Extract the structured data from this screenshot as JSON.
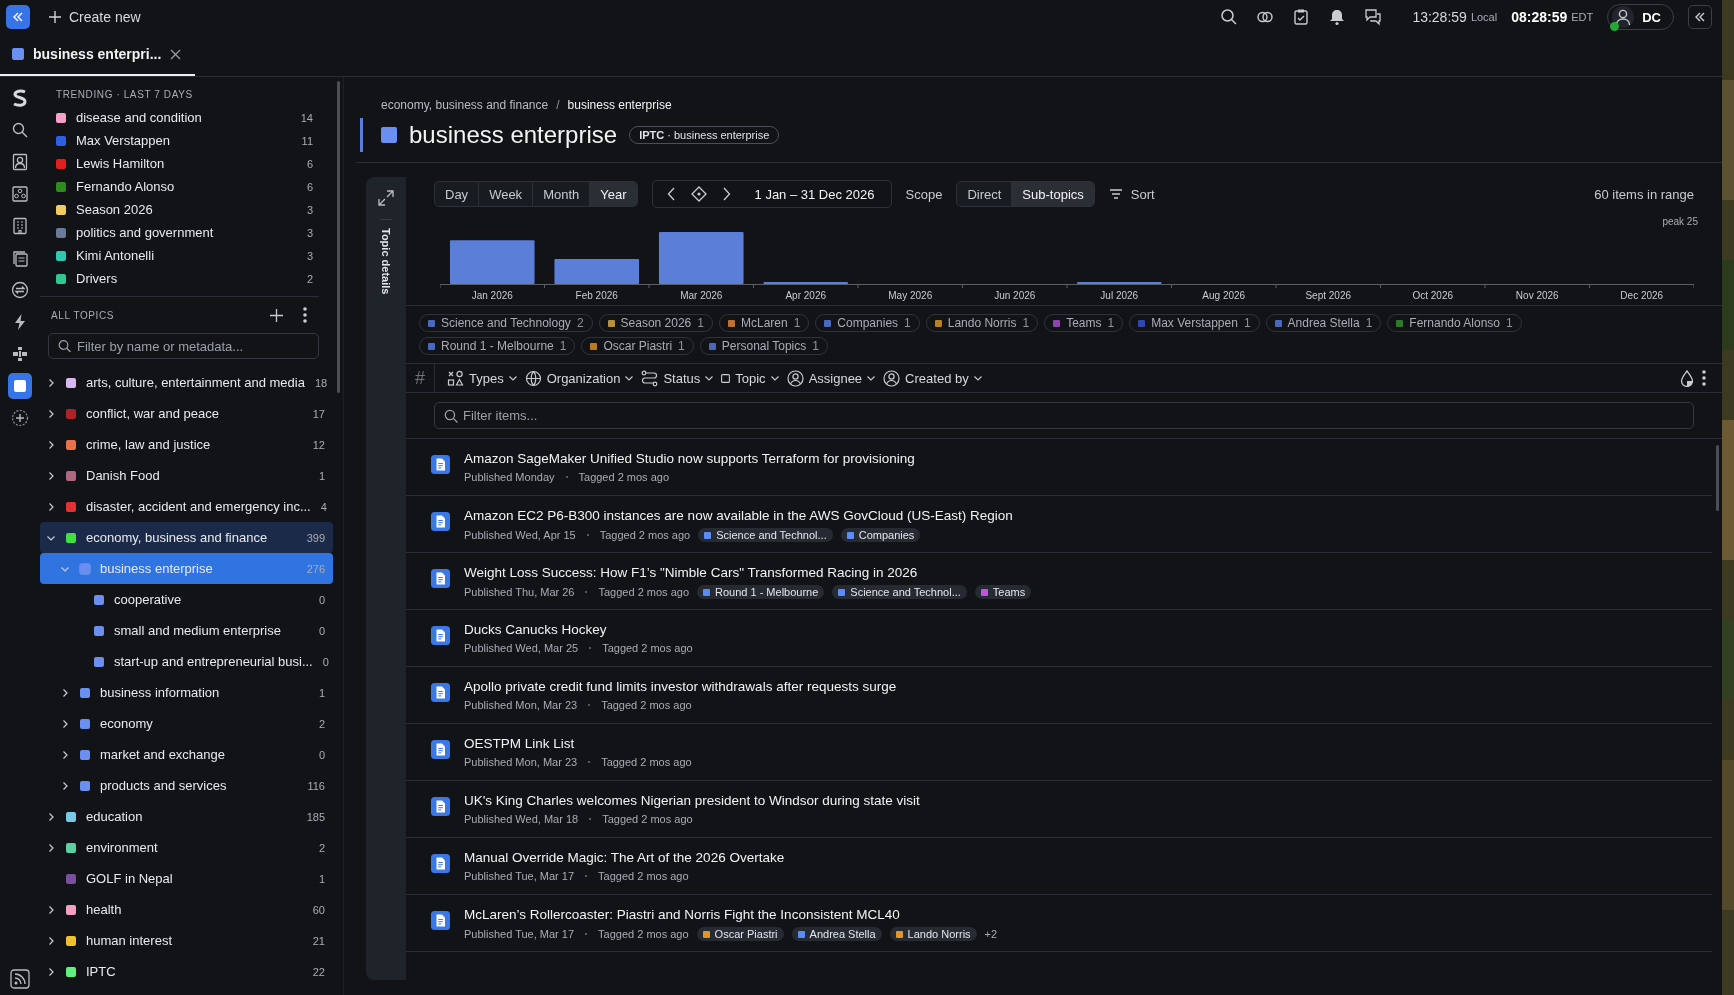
{
  "top_bar": {
    "create_label": "Create new",
    "local_time": "13:28:59",
    "local_label": "Local",
    "remote_time": "08:28:59",
    "remote_label": "EDT",
    "user_initials": "DC"
  },
  "rail": [
    {
      "selected": false
    },
    {
      "selected": false
    },
    {
      "selected": false
    },
    {
      "selected": false
    },
    {
      "selected": false
    },
    {
      "selected": false
    },
    {
      "selected": false
    },
    {
      "selected": false
    },
    {
      "selected": false
    },
    {
      "selected": true
    },
    {
      "selected": false
    }
  ],
  "tabs": [
    {
      "label": "business enterpri...",
      "selected": true
    }
  ],
  "sidebar": {
    "trending_title": "TRENDING · LAST 7 DAYS",
    "trending": [
      {
        "label": "disease and condition",
        "count": "14",
        "color": "#f5a0c8"
      },
      {
        "label": "Max Verstappen",
        "count": "11",
        "color": "#2f5fe0"
      },
      {
        "label": "Lewis Hamilton",
        "count": "6",
        "color": "#e02020"
      },
      {
        "label": "Fernando Alonso",
        "count": "6",
        "color": "#2f8a20"
      },
      {
        "label": "Season 2026",
        "count": "3",
        "color": "#f0cc60"
      },
      {
        "label": "politics and government",
        "count": "3",
        "color": "#6a7a9a"
      },
      {
        "label": "Kimi Antonelli",
        "count": "3",
        "color": "#30c8b0"
      },
      {
        "label": "Drivers",
        "count": "2",
        "color": "#30c890"
      }
    ],
    "all_topics_title": "ALL TOPICS",
    "filter_placeholder": "Filter by name or metadata...",
    "tree": [
      {
        "label": "arts, culture, entertainment and media",
        "count": "18",
        "color": "#d6b8f0",
        "expanded": false,
        "selected": false
      },
      {
        "label": "conflict, war and peace",
        "count": "17",
        "color": "#b0202a",
        "expanded": false,
        "selected": false
      },
      {
        "label": "crime, law and justice",
        "count": "12",
        "color": "#e8704a",
        "expanded": false,
        "selected": false
      },
      {
        "label": "Danish Food",
        "count": "1",
        "color": "#b06880",
        "expanded": false,
        "selected": false
      },
      {
        "label": "disaster, accident and emergency inc...",
        "count": "4",
        "color": "#e83030",
        "expanded": false,
        "selected": false
      },
      {
        "label": "economy, business and finance",
        "count": "399",
        "color": "#40e040",
        "expanded": true,
        "selected": false,
        "children": [
          {
            "label": "business enterprise",
            "count": "276",
            "color": "#6b8ff0",
            "expanded": true,
            "selected": true,
            "children": [
              {
                "label": "cooperative",
                "count": "0",
                "color": "#6b8ff0",
                "selected": false
              },
              {
                "label": "small and medium enterprise",
                "count": "0",
                "color": "#6b8ff0",
                "selected": false
              },
              {
                "label": "start-up and entrepreneurial busi...",
                "count": "0",
                "color": "#6b8ff0",
                "selected": false
              }
            ]
          },
          {
            "label": "business information",
            "count": "1",
            "color": "#6b8ff0",
            "expanded": false,
            "selected": false
          },
          {
            "label": "economy",
            "count": "2",
            "color": "#6b8ff0",
            "expanded": false,
            "selected": false
          },
          {
            "label": "market and exchange",
            "count": "0",
            "color": "#6b8ff0",
            "expanded": false,
            "selected": false
          },
          {
            "label": "products and services",
            "count": "116",
            "color": "#6b8ff0",
            "expanded": false,
            "selected": false
          }
        ]
      },
      {
        "label": "education",
        "count": "185",
        "color": "#7ac8e8",
        "expanded": false,
        "selected": false
      },
      {
        "label": "environment",
        "count": "2",
        "color": "#5ad0a0",
        "expanded": false,
        "selected": false
      },
      {
        "label": "GOLF in Nepal",
        "count": "1",
        "color": "#7a4fa0",
        "selected": false
      },
      {
        "label": "health",
        "count": "60",
        "color": "#f5a0c0",
        "expanded": false,
        "selected": false
      },
      {
        "label": "human interest",
        "count": "21",
        "color": "#f0c030",
        "expanded": false,
        "selected": false
      },
      {
        "label": "IPTC",
        "count": "22",
        "color": "#60f080",
        "expanded": false,
        "selected": false
      }
    ]
  },
  "topic": {
    "breadcrumb": [
      "economy, business and finance",
      "business enterprise"
    ],
    "separator": "/",
    "title": "business enterprise",
    "badge": "**IPTC** · business enterprise"
  },
  "side_tab": "Topic details",
  "ranges": [
    {
      "label": "Day",
      "selected": false
    },
    {
      "label": "Week",
      "selected": false
    },
    {
      "label": "Month",
      "selected": false
    },
    {
      "label": "Year",
      "selected": true
    }
  ],
  "date_range": "1 Jan – 31 Dec 2026",
  "scope_label": "Scope",
  "scopes": [
    {
      "label": "Direct",
      "selected": false
    },
    {
      "label": "Sub-topics",
      "selected": true
    }
  ],
  "sort_label": "Sort",
  "count_label": "60 items in range",
  "timeline": {
    "peak_label": "peak 25",
    "months": [
      "Jan 2026",
      "Feb 2026",
      "Mar 2026",
      "Apr 2026",
      "May 2026",
      "Jun 2026",
      "Jul 2026",
      "Aug 2026",
      "Sept 2026",
      "Oct 2026",
      "Nov 2026",
      "Dec 2026"
    ]
  },
  "topic_chips": [
    {
      "label": "Science and Technology",
      "count": "2",
      "color": "#4a68c0"
    },
    {
      "label": "Season 2026",
      "count": "1",
      "color": "#b8913a"
    },
    {
      "label": "McLaren",
      "count": "1",
      "color": "#c07030"
    },
    {
      "label": "Companies",
      "count": "1",
      "color": "#4a68c0"
    },
    {
      "label": "Lando Norris",
      "count": "1",
      "color": "#b88020"
    },
    {
      "label": "Teams",
      "count": "1",
      "color": "#9040b0"
    },
    {
      "label": "Max Verstappen",
      "count": "1",
      "color": "#2f48b0"
    },
    {
      "label": "Andrea Stella",
      "count": "1",
      "color": "#4a68c0"
    },
    {
      "label": "Fernando Alonso",
      "count": "1",
      "color": "#2f7a2a"
    },
    {
      "label": "Round 1 - Melbourne",
      "count": "1",
      "color": "#4a68c0"
    },
    {
      "label": "Oscar Piastri",
      "count": "1",
      "color": "#b87a20"
    },
    {
      "label": "Personal Topics",
      "count": "1",
      "color": "#4a68c0"
    }
  ],
  "hash_symbol": "#",
  "filters": [
    "Types",
    "Organization",
    "Status",
    "Topic",
    "Assignee",
    "Created by"
  ],
  "item_filter_placeholder": "Filter items...",
  "items": [
    {
      "title": "Amazon SageMaker Unified Studio now supports Terraform for provisioning",
      "published": "Published Monday",
      "tagged": "Tagged 2 mos ago"
    },
    {
      "title": "Amazon EC2 P6-B300 instances are now available in the AWS GovCloud (US-East) Region",
      "published": "Published Wed, Apr 15",
      "tagged": "Tagged 2 mos ago",
      "tags": [
        {
          "label": "Science and Technol...",
          "color": "#5b8cf5"
        },
        {
          "label": "Companies",
          "color": "#5b8cf5"
        }
      ]
    },
    {
      "title": "Weight Loss Success: How F1’s \"Nimble Cars\" Transformed Racing in 2026",
      "published": "Published Thu, Mar 26",
      "tagged": "Tagged 2 mos ago",
      "tags": [
        {
          "label": "Round 1 - Melbourne",
          "color": "#5b8cf5"
        },
        {
          "label": "Science and Technol...",
          "color": "#5b8cf5"
        },
        {
          "label": "Teams",
          "color": "#c850e8"
        }
      ]
    },
    {
      "title": "Ducks Canucks Hockey",
      "published": "Published Wed, Mar 25",
      "tagged": "Tagged 2 mos ago"
    },
    {
      "title": "Apollo private credit fund limits investor withdrawals after requests surge",
      "published": "Published Mon, Mar 23",
      "tagged": "Tagged 2 mos ago"
    },
    {
      "title": "OESTPM Link List",
      "published": "Published Mon, Mar 23",
      "tagged": "Tagged 2 mos ago"
    },
    {
      "title": "UK's King Charles welcomes Nigerian president to Windsor during state visit",
      "published": "Published Wed, Mar 18",
      "tagged": "Tagged 2 mos ago"
    },
    {
      "title": "Manual Override Magic: The Art of the 2026 Overtake",
      "published": "Published Tue, Mar 17",
      "tagged": "Tagged 2 mos ago"
    },
    {
      "title": "McLaren’s Rollercoaster: Piastri and Norris Fight the Inconsistent MCL40",
      "published": "Published Tue, Mar 17",
      "tagged": "Tagged 2 mos ago",
      "tags": [
        {
          "label": "Oscar Piastri",
          "color": "#e0962a"
        },
        {
          "label": "Andrea Stella",
          "color": "#5b8cf5"
        },
        {
          "label": "Lando Norris",
          "color": "#e0962a"
        }
      ],
      "more": "+2"
    }
  ]
}
